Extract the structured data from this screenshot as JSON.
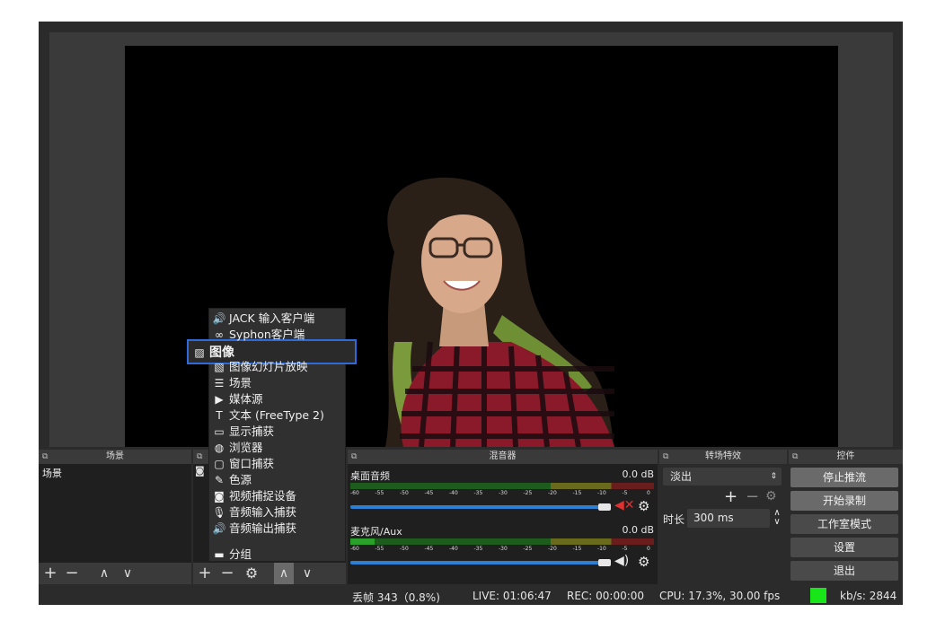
{
  "docks": {
    "scenes": "场景",
    "mixer": "混音器",
    "transitions": "转场特效",
    "controls": "控件"
  },
  "scenes_list": [
    "场景"
  ],
  "source_menu": [
    {
      "icon": "speaker-icon",
      "glyph": "🔊",
      "label": "JACK 输入客户端"
    },
    {
      "icon": "syphon-icon",
      "glyph": "∞",
      "label": "Syphon客户端"
    },
    {
      "icon": "image-icon",
      "glyph": "▨",
      "label": "图像"
    },
    {
      "icon": "slideshow-icon",
      "glyph": "▧",
      "label": "图像幻灯片放映"
    },
    {
      "icon": "list-icon",
      "glyph": "☰",
      "label": "场景"
    },
    {
      "icon": "play-icon",
      "glyph": "▶",
      "label": "媒体源"
    },
    {
      "icon": "text-icon",
      "glyph": "T",
      "label": "文本 (FreeType 2)"
    },
    {
      "icon": "monitor-icon",
      "glyph": "▭",
      "label": "显示捕获"
    },
    {
      "icon": "globe-icon",
      "glyph": "◍",
      "label": "浏览器"
    },
    {
      "icon": "window-icon",
      "glyph": "▢",
      "label": "窗口捕获"
    },
    {
      "icon": "brush-icon",
      "glyph": "✎",
      "label": "色源"
    },
    {
      "icon": "camera-icon",
      "glyph": "◙",
      "label": "视频捕捉设备"
    },
    {
      "icon": "mic-icon",
      "glyph": "🎙",
      "label": "音频输入捕获"
    },
    {
      "icon": "speaker-icon",
      "glyph": "🔊",
      "label": "音频输出捕获"
    },
    {
      "icon": "folder-icon",
      "glyph": "▬",
      "label": "分组"
    }
  ],
  "mixer": {
    "channels": [
      {
        "name": "桌面音频",
        "db": "0.0 dB",
        "muted": true
      },
      {
        "name": "麦克风/Aux",
        "db": "0.0 dB",
        "muted": false
      }
    ],
    "ticks": [
      "-60",
      "-55",
      "-50",
      "-45",
      "-40",
      "-35",
      "-30",
      "-25",
      "-20",
      "-15",
      "-10",
      "-5",
      "0"
    ]
  },
  "transitions": {
    "selected": "淡出",
    "duration_label": "时长",
    "duration_value": "300 ms"
  },
  "controls": [
    "停止推流",
    "开始录制",
    "工作室模式",
    "设置",
    "退出"
  ],
  "status": {
    "dropped": "丢帧 343（0.8%)",
    "live": "LIVE: 01:06:47",
    "rec": "REC: 00:00:00",
    "cpu": "CPU: 17.3%, 30.00 fps",
    "kbps": "kb/s: 2844",
    "indicator_color": "#19e619"
  }
}
